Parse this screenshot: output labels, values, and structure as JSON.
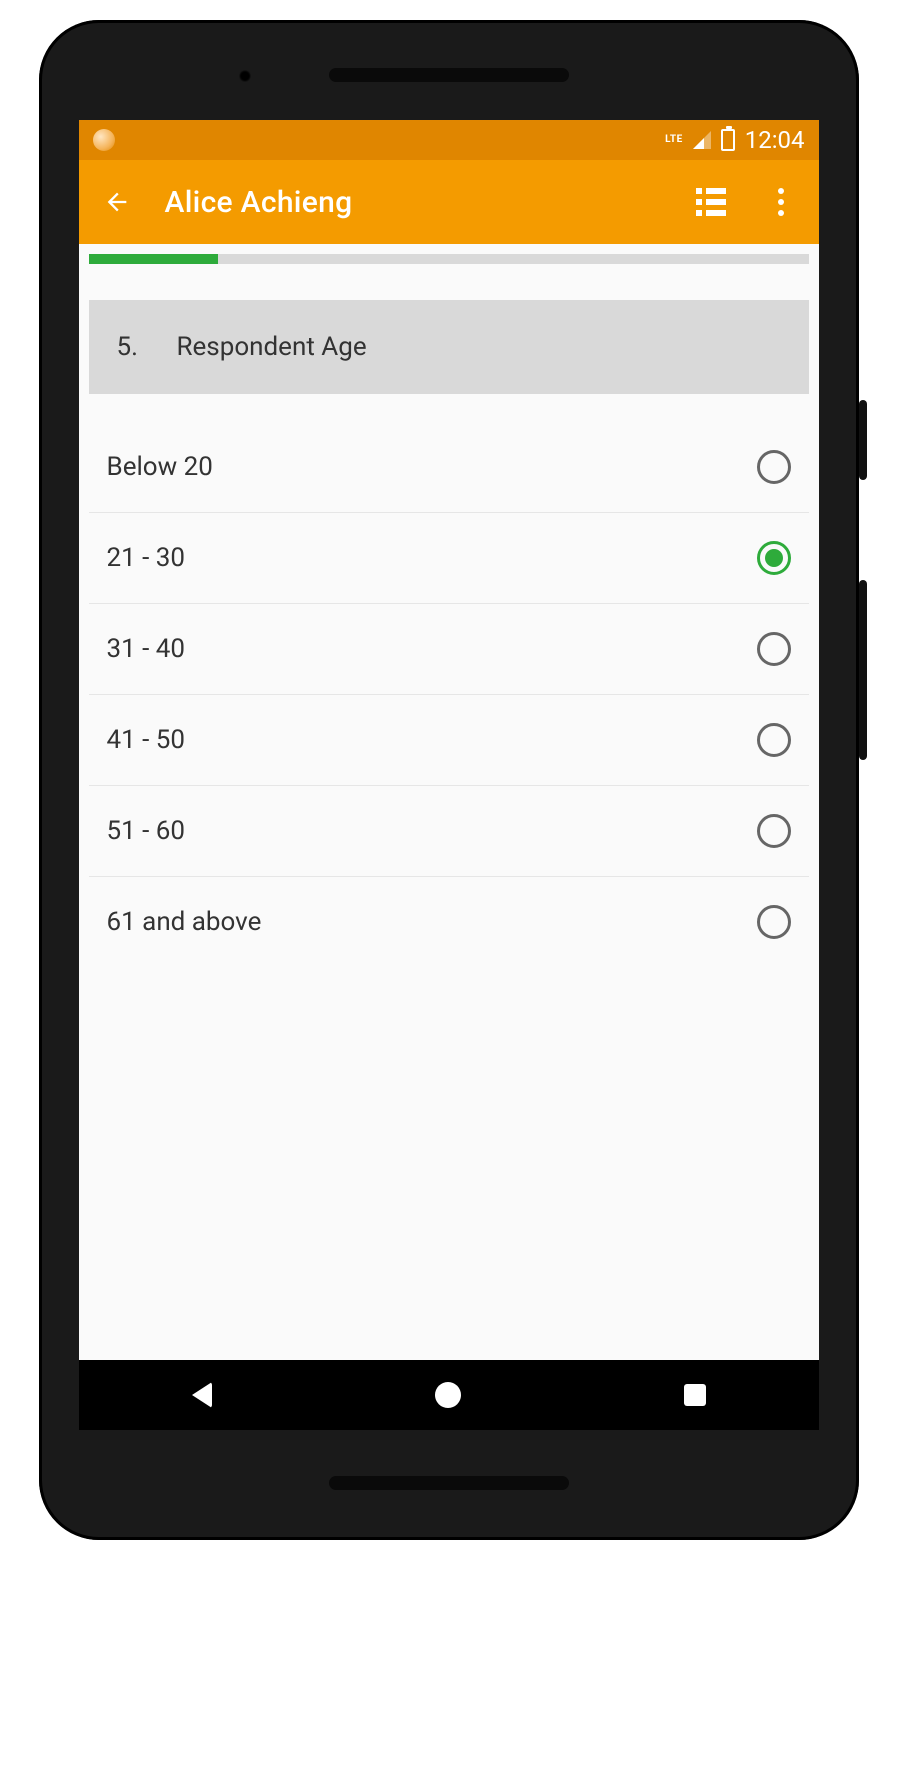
{
  "statusbar": {
    "time": "12:04",
    "network_label": "LTE"
  },
  "appbar": {
    "title": "Alice Achieng"
  },
  "progress": {
    "percent": 18
  },
  "question": {
    "number": "5.",
    "title": "Respondent Age"
  },
  "options": [
    {
      "label": "Below 20",
      "selected": false
    },
    {
      "label": "21 - 30",
      "selected": true
    },
    {
      "label": "31 - 40",
      "selected": false
    },
    {
      "label": "41 - 50",
      "selected": false
    },
    {
      "label": "51 - 60",
      "selected": false
    },
    {
      "label": "61 and above",
      "selected": false
    }
  ]
}
